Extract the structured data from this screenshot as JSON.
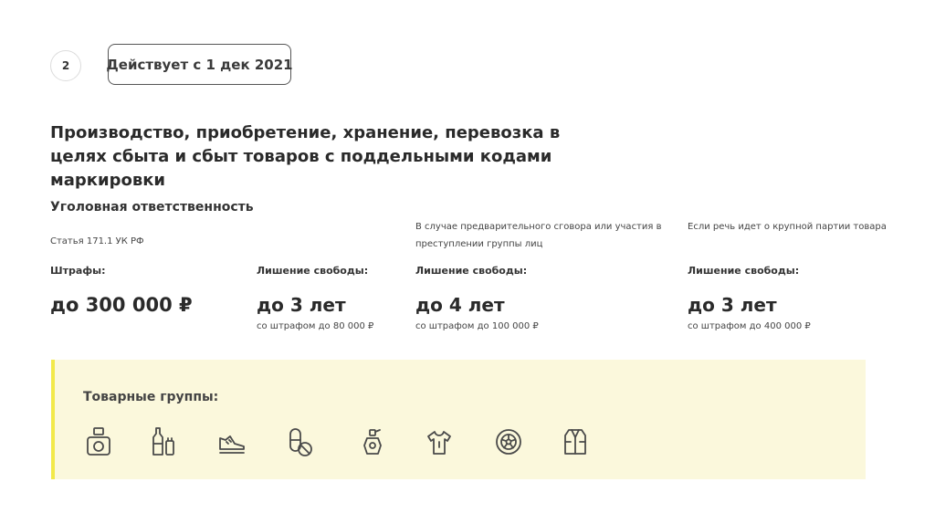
{
  "header": {
    "step_number": "2",
    "effective_date": "Действует с 1 дек 2021"
  },
  "title": "Производство, приобретение, хранение, перевозка в целях сбыта и сбыт товаров с поддельными кодами маркировки",
  "responsibility": {
    "heading": "Уголовная ответственность",
    "article": "Статья  171.1 УК РФ"
  },
  "columns": [
    {
      "condition": "",
      "label": "Штрафы:",
      "value": "до 300 000 ₽",
      "note": ""
    },
    {
      "condition": "",
      "label": "Лишение свободы:",
      "value": "до 3 лет",
      "note": "со штрафом до 80 000 ₽"
    },
    {
      "condition": "В случае предварительного сговора или участия в преступлении группы лиц",
      "label": "Лишение свободы:",
      "value": "до 4 лет",
      "note": "со штрафом до 100 000 ₽"
    },
    {
      "condition": "Если речь идет о крупной партии товара",
      "label": "Лишение свободы:",
      "value": "до 3 лет",
      "note": "со штрафом до 400 000 ₽"
    }
  ],
  "product_groups": {
    "heading": "Товарные группы:",
    "icons": [
      "camera-icon",
      "bottles-icon",
      "sneaker-icon",
      "pills-icon",
      "perfume-icon",
      "shirt-icon",
      "tire-icon",
      "fur-coat-icon"
    ]
  },
  "colors": {
    "panel_background": "#fbf8dc",
    "panel_accent": "#f2e94a",
    "text": "#2b2b2b"
  }
}
